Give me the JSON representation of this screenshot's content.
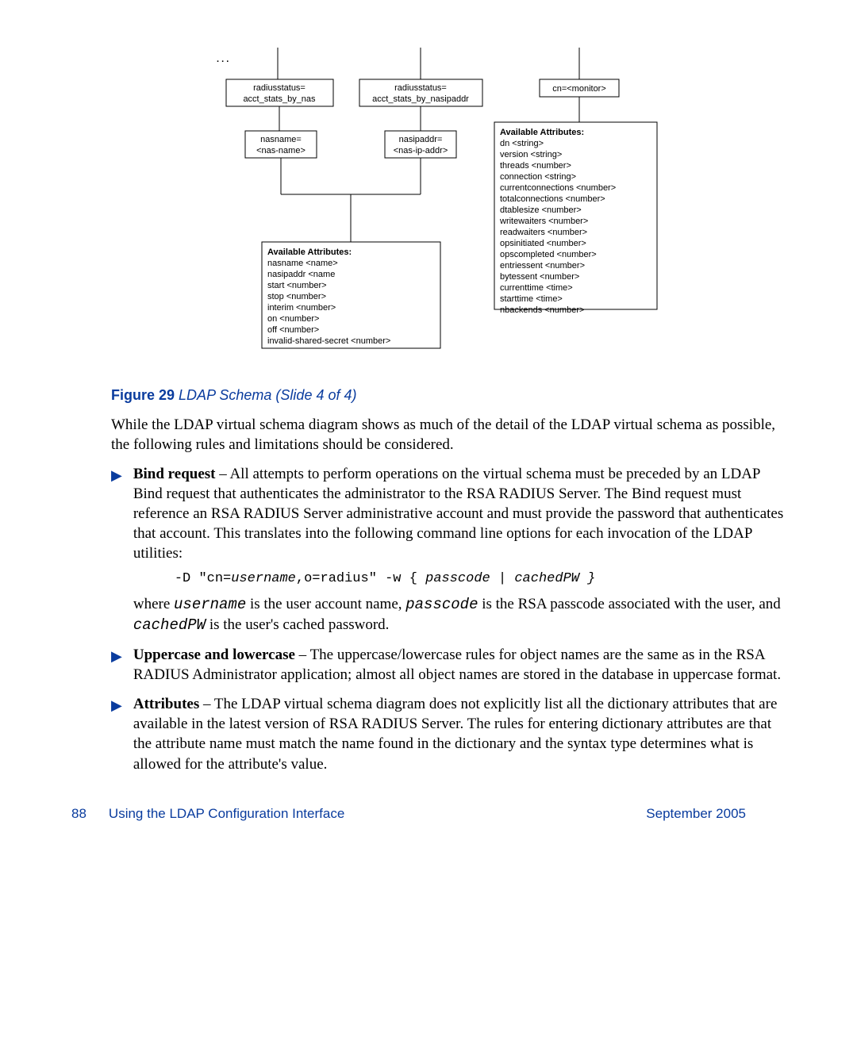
{
  "diagram": {
    "ellipsis": ". . .",
    "box1a": "radiusstatus=\nacct_stats_by_nas",
    "box1b": "radiusstatus=\nacct_stats_by_nasipaddr",
    "box1c": "cn=<monitor>",
    "box2a": "nasname=\n<nas-name>",
    "box2b": "nasipaddr=\n<nas-ip-addr>",
    "attr1_title": "Available Attributes:",
    "attr1_lines": [
      "dn <string>",
      "version <string>",
      "threads <number>",
      "connection <string>",
      "currentconnections <number>",
      "totalconnections <number>",
      "dtablesize <number>",
      "writewaiters <number>",
      "readwaiters <number>",
      "opsinitiated <number>",
      "opscompleted <number>",
      "entriessent <number>",
      "bytessent <number>",
      "currenttime <time>",
      "starttime <time>",
      "nbackends <number>"
    ],
    "attr2_title": "Available Attributes:",
    "attr2_lines": [
      "nasname <name>",
      "nasipaddr <name",
      "start <number>",
      "stop <number>",
      "interim <number>",
      "on <number>",
      "off <number>",
      "invalid-shared-secret <number>"
    ]
  },
  "caption": {
    "label": "Figure 29",
    "title": "LDAP Schema (Slide 4 of 4)"
  },
  "intro": "While the LDAP virtual schema diagram shows as much of the detail of the LDAP virtual schema as possible, the following rules and limitations should be considered.",
  "bullets": {
    "b1": {
      "term": "Bind request",
      "text": " – All attempts to perform operations on the virtual schema must be preceded by an LDAP Bind request that authenticates the administrator to the RSA RADIUS Server. The Bind request must reference an RSA RADIUS Server administrative account and must provide the password that authenticates that account. This translates into the following command line options for each invocation of the LDAP utilities:"
    },
    "code": {
      "prefix": "-D \"cn=",
      "user": "username",
      "mid": ",o=radius\" -w { ",
      "pass": "passcode",
      "pipe": " | ",
      "cached": "cachedPW }"
    },
    "b1sub": {
      "w1": "where ",
      "user": "username",
      "w2": " is the user account name, ",
      "pass": "passcode",
      "w3": " is the RSA passcode associated with the user, and ",
      "cached": "cachedPW",
      "w4": " is the user's cached password."
    },
    "b2": {
      "term": "Uppercase and lowercase",
      "text": " – The uppercase/lowercase rules for object names are the same as in the RSA RADIUS Administrator application; almost all object names are stored in the database in uppercase format."
    },
    "b3": {
      "term": "Attributes",
      "text": " – The LDAP virtual schema diagram does not explicitly list all the dictionary attributes that are available in the latest version of RSA RADIUS Server. The rules for entering dictionary attributes are that the attribute name must match the name found in the dictionary and the syntax type determines what is allowed for the attribute's value."
    }
  },
  "footer": {
    "page": "88",
    "section": "Using the LDAP Configuration Interface",
    "date": "September 2005"
  }
}
